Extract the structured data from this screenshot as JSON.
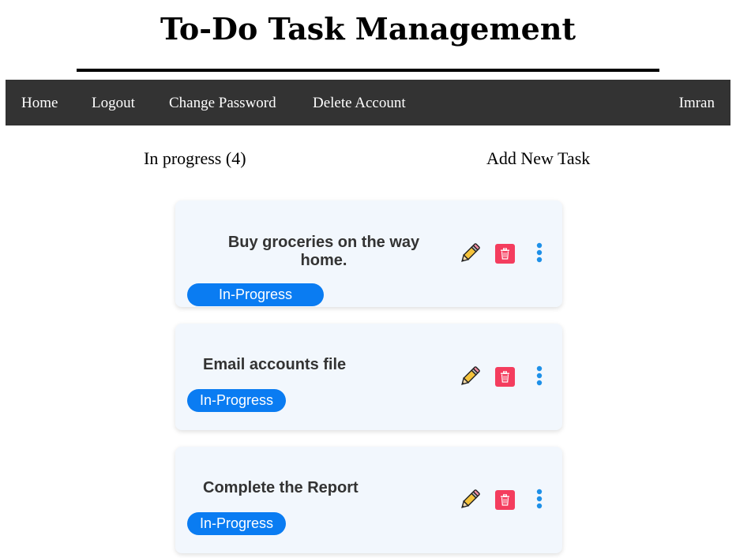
{
  "header": {
    "title": "To-Do Task Management"
  },
  "nav": {
    "home": "Home",
    "logout": "Logout",
    "change_password": "Change Password",
    "delete_account": "Delete Account",
    "user": "Imran"
  },
  "sections": {
    "in_progress": "In progress (4)",
    "add_new_task": "Add New Task"
  },
  "tasks": [
    {
      "title": "Buy groceries on the way home.",
      "status": "In-Progress"
    },
    {
      "title": "Email accounts file",
      "status": "In-Progress"
    },
    {
      "title": "Complete the Report",
      "status": "In-Progress"
    }
  ],
  "icons": {
    "edit": "pencil-icon",
    "delete": "trash-icon",
    "more": "vertical-dots-icon"
  },
  "colors": {
    "navbar": "#333333",
    "badge": "#0a7cf2",
    "delete": "#f43d5e",
    "more": "#1e90e8",
    "card": "#f2f7fd"
  }
}
